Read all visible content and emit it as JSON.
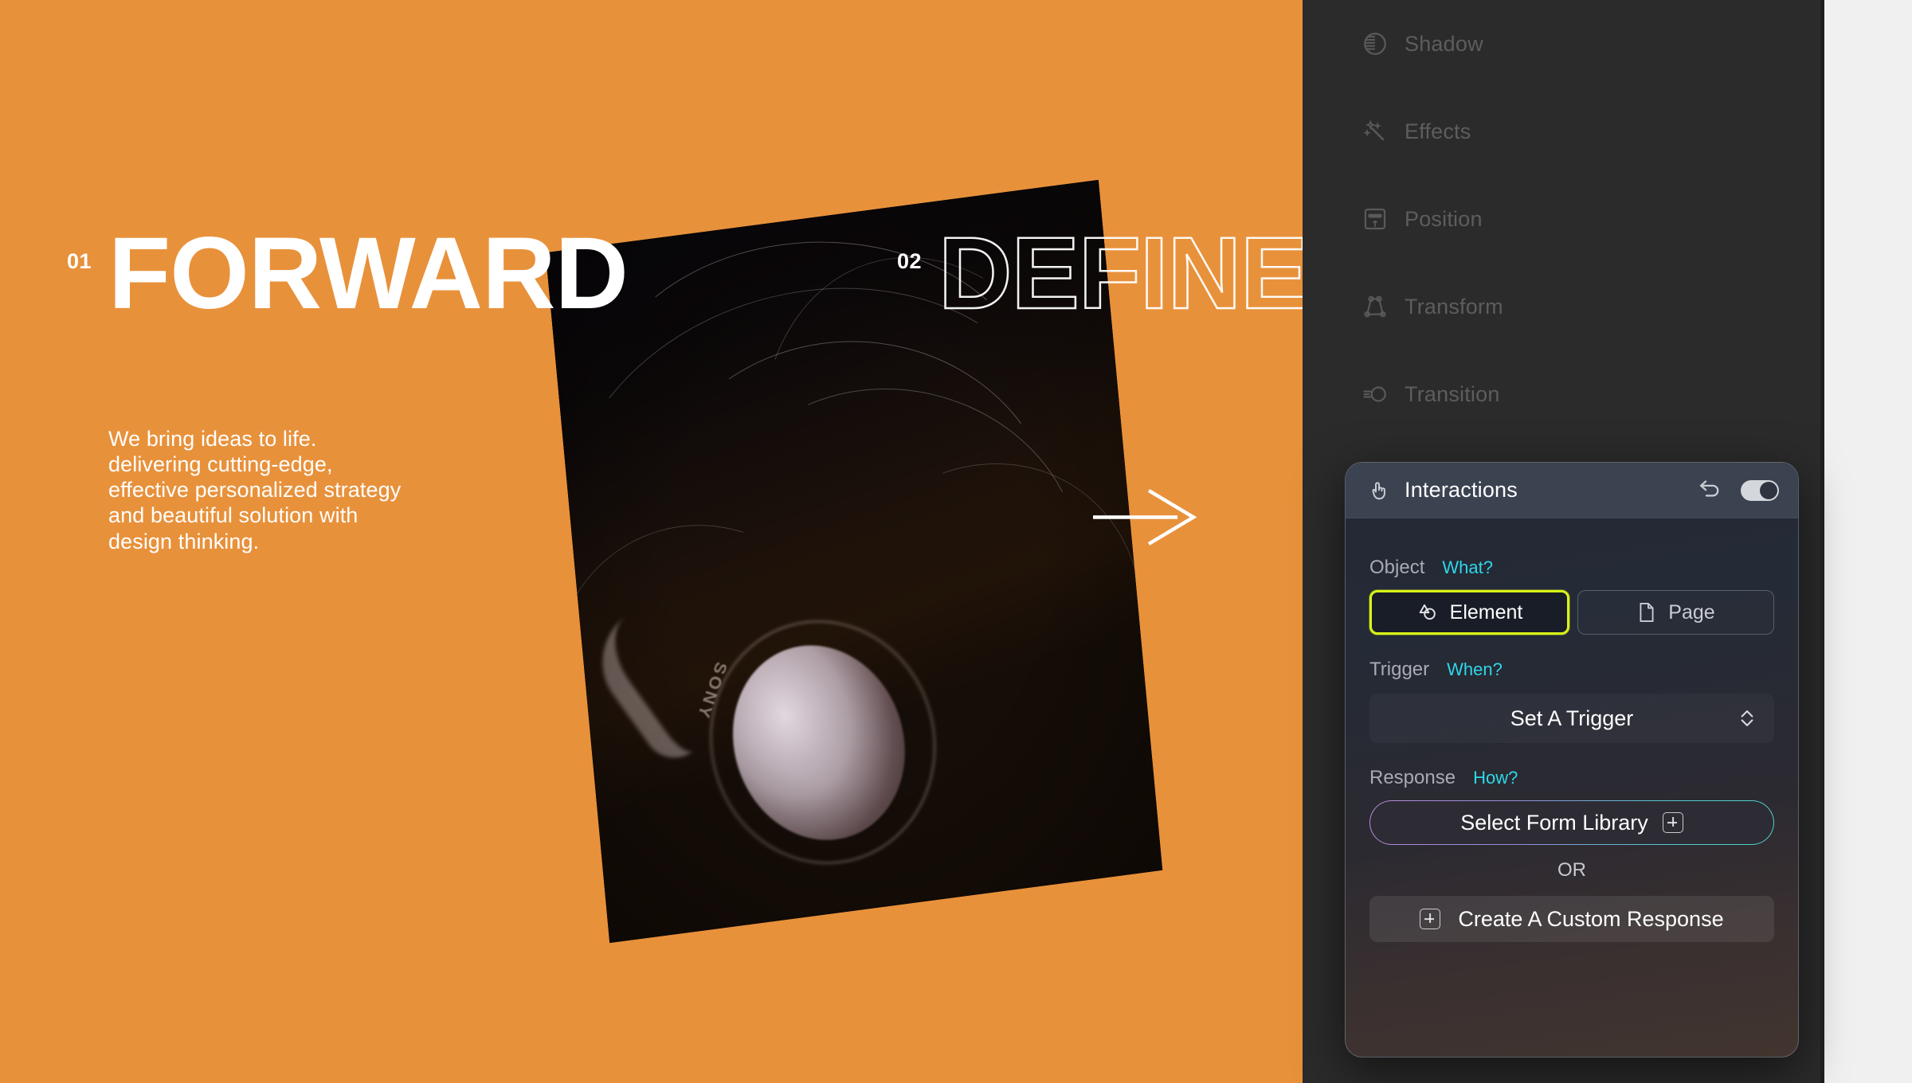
{
  "canvas": {
    "background_color": "#e8913b",
    "slides": [
      {
        "number": "01",
        "title": "FORWARD",
        "style": "solid"
      },
      {
        "number": "02",
        "title": "DEFINE",
        "style": "outline"
      }
    ],
    "paragraph": "We bring ideas to life.\ndelivering cutting-edge,\neffective personalized strategy\nand beautiful solution with\ndesign thinking.",
    "next_arrow": "arrow-right-icon",
    "photo_alt": "person with flowing hair wearing headphones"
  },
  "editor": {
    "properties": [
      {
        "label": "Shadow",
        "icon": "shadow-icon"
      },
      {
        "label": "Effects",
        "icon": "effects-icon"
      },
      {
        "label": "Position",
        "icon": "position-icon"
      },
      {
        "label": "Transform",
        "icon": "transform-icon"
      },
      {
        "label": "Transition",
        "icon": "transition-icon"
      }
    ]
  },
  "interactions": {
    "title": "Interactions",
    "title_icon": "tap-hand-icon",
    "undo_icon": "undo-icon",
    "toggle": {
      "name": "interactions-toggle",
      "state": "on"
    },
    "object": {
      "label": "Object",
      "hint": "What?",
      "options": [
        {
          "label": "Element",
          "icon": "shapes-icon",
          "selected": true
        },
        {
          "label": "Page",
          "icon": "document-icon",
          "selected": false
        }
      ]
    },
    "trigger": {
      "label": "Trigger",
      "hint": "When?",
      "value": "Set A Trigger",
      "caret_icon": "chevron-up-down-icon"
    },
    "response": {
      "label": "Response",
      "hint": "How?",
      "library_button": "Select Form Library",
      "library_icon": "plus-box-icon",
      "divider": "OR",
      "custom_button": "Create A Custom Response",
      "custom_icon": "plus-box-icon"
    },
    "colors": {
      "accent_highlight": "#d9f418",
      "hint_text": "#2fd7e8",
      "header_bg": "#3b4351"
    }
  }
}
